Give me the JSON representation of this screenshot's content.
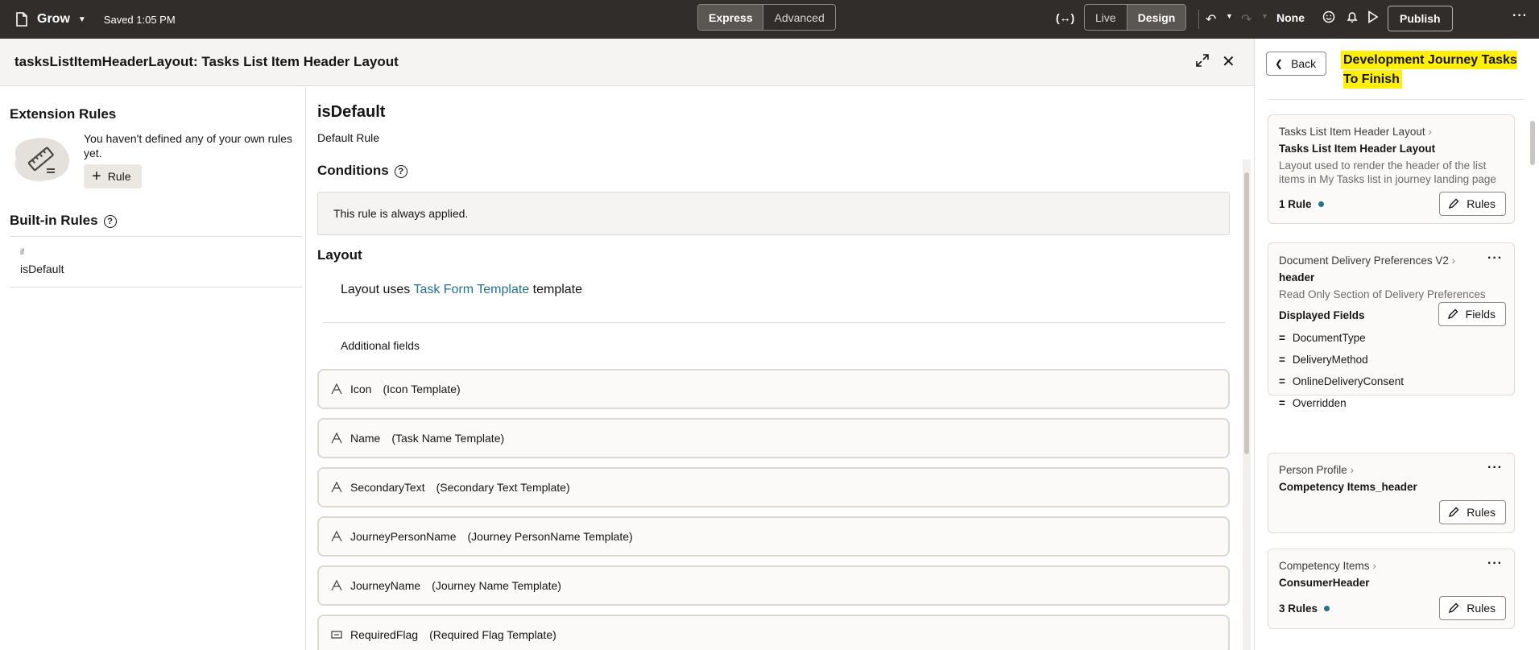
{
  "topbar": {
    "app_name": "Grow",
    "saved": "Saved 1:05 PM",
    "mode_express": "Express",
    "mode_advanced": "Advanced",
    "view_live": "Live",
    "view_design": "Design",
    "sandbox": "None",
    "publish": "Publish"
  },
  "header": {
    "title": "tasksListItemHeaderLayout: Tasks List Item Header Layout"
  },
  "rules_pane": {
    "extension_title": "Extension Rules",
    "empty_message": "You haven't defined any of your own rules yet.",
    "add_rule_label": "Rule",
    "builtin_title": "Built-in Rules",
    "builtin_if": "if",
    "builtin_name": "isDefault"
  },
  "detail": {
    "title": "isDefault",
    "subtitle": "Default Rule",
    "conditions_title": "Conditions",
    "condition_text": "This rule is always applied.",
    "layout_title": "Layout",
    "layout_prefix": "Layout uses",
    "layout_link": "Task Form Template",
    "layout_suffix": "template",
    "additional_fields": "Additional fields",
    "fields": [
      {
        "name": "Icon",
        "template": "(Icon Template)",
        "icon": "text-field-icon"
      },
      {
        "name": "Name",
        "template": "(Task Name Template)",
        "icon": "text-field-icon"
      },
      {
        "name": "SecondaryText",
        "template": "(Secondary Text Template)",
        "icon": "text-field-icon"
      },
      {
        "name": "JourneyPersonName",
        "template": "(Journey PersonName Template)",
        "icon": "text-field-icon"
      },
      {
        "name": "JourneyName",
        "template": "(Journey Name Template)",
        "icon": "text-field-icon"
      },
      {
        "name": "RequiredFlag",
        "template": "(Required Flag Template)",
        "icon": "flag-field-icon"
      }
    ]
  },
  "right_panel": {
    "back_label": "Back",
    "title": "Development Journey Tasks To Finish",
    "cards": [
      {
        "crumb": "Tasks List Item Header Layout",
        "name": "Tasks List Item Header Layout",
        "description": "Layout used to render the header of the list items in My Tasks list in journey landing page",
        "count": "1 Rule",
        "button": "Rules"
      },
      {
        "crumb": "Document Delivery Preferences V2",
        "name": "header",
        "description": "Read Only Section of Delivery Preferences",
        "count": "Displayed Fields",
        "button": "Fields",
        "fields": [
          "DocumentType",
          "DeliveryMethod",
          "OnlineDeliveryConsent",
          "Overridden"
        ]
      },
      {
        "crumb": "Person Profile",
        "name": "Competency Items_header",
        "button": "Rules"
      },
      {
        "crumb": "Competency Items",
        "name": "ConsumerHeader",
        "count": "3 Rules",
        "button": "Rules"
      }
    ]
  },
  "colors": {
    "topbar": "#312d2a",
    "link": "#227294",
    "highlight": "#ffef0a",
    "dot": "#227294"
  }
}
